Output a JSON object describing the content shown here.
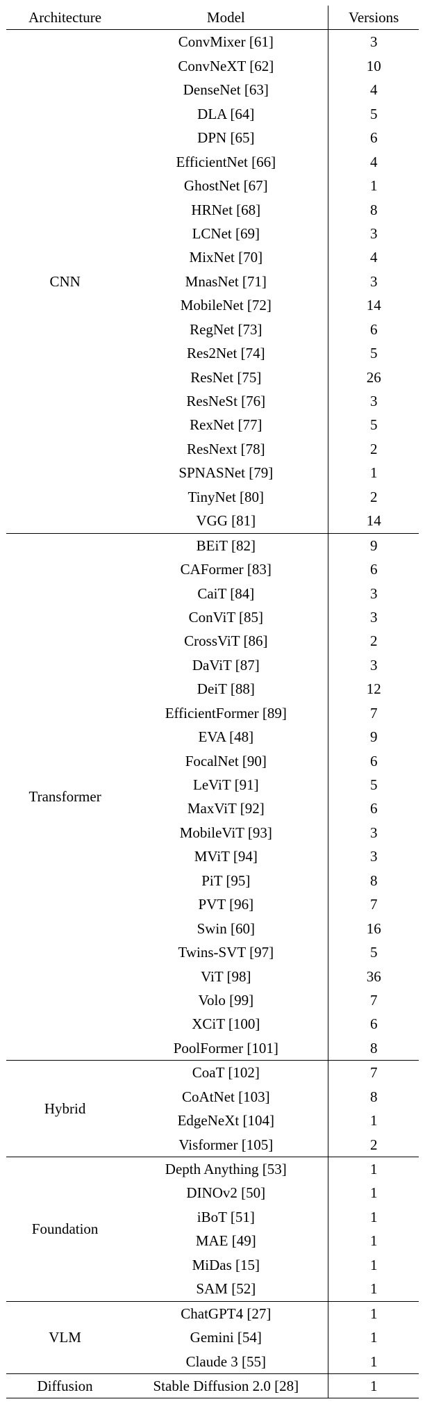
{
  "chart_data": {
    "type": "table",
    "columns": [
      "Architecture",
      "Model",
      "Versions"
    ],
    "groups": [
      {
        "architecture": "CNN",
        "rows": [
          {
            "model": "ConvMixer",
            "ref": 61,
            "versions": 3
          },
          {
            "model": "ConvNeXT",
            "ref": 62,
            "versions": 10
          },
          {
            "model": "DenseNet",
            "ref": 63,
            "versions": 4
          },
          {
            "model": "DLA",
            "ref": 64,
            "versions": 5
          },
          {
            "model": "DPN",
            "ref": 65,
            "versions": 6
          },
          {
            "model": "EfficientNet",
            "ref": 66,
            "versions": 4
          },
          {
            "model": "GhostNet",
            "ref": 67,
            "versions": 1
          },
          {
            "model": "HRNet",
            "ref": 68,
            "versions": 8
          },
          {
            "model": "LCNet",
            "ref": 69,
            "versions": 3
          },
          {
            "model": "MixNet",
            "ref": 70,
            "versions": 4
          },
          {
            "model": "MnasNet",
            "ref": 71,
            "versions": 3
          },
          {
            "model": "MobileNet",
            "ref": 72,
            "versions": 14
          },
          {
            "model": "RegNet",
            "ref": 73,
            "versions": 6
          },
          {
            "model": "Res2Net",
            "ref": 74,
            "versions": 5
          },
          {
            "model": "ResNet",
            "ref": 75,
            "versions": 26
          },
          {
            "model": "ResNeSt",
            "ref": 76,
            "versions": 3
          },
          {
            "model": "RexNet",
            "ref": 77,
            "versions": 5
          },
          {
            "model": "ResNext",
            "ref": 78,
            "versions": 2
          },
          {
            "model": "SPNASNet",
            "ref": 79,
            "versions": 1
          },
          {
            "model": "TinyNet",
            "ref": 80,
            "versions": 2
          },
          {
            "model": "VGG",
            "ref": 81,
            "versions": 14
          }
        ]
      },
      {
        "architecture": "Transformer",
        "rows": [
          {
            "model": "BEiT",
            "ref": 82,
            "versions": 9
          },
          {
            "model": "CAFormer",
            "ref": 83,
            "versions": 6
          },
          {
            "model": "CaiT",
            "ref": 84,
            "versions": 3
          },
          {
            "model": "ConViT",
            "ref": 85,
            "versions": 3
          },
          {
            "model": "CrossViT",
            "ref": 86,
            "versions": 2
          },
          {
            "model": "DaViT",
            "ref": 87,
            "versions": 3
          },
          {
            "model": "DeiT",
            "ref": 88,
            "versions": 12
          },
          {
            "model": "EfficientFormer",
            "ref": 89,
            "versions": 7
          },
          {
            "model": "EVA",
            "ref": 48,
            "versions": 9
          },
          {
            "model": "FocalNet",
            "ref": 90,
            "versions": 6
          },
          {
            "model": "LeViT",
            "ref": 91,
            "versions": 5
          },
          {
            "model": "MaxViT",
            "ref": 92,
            "versions": 6
          },
          {
            "model": "MobileViT",
            "ref": 93,
            "versions": 3
          },
          {
            "model": "MViT",
            "ref": 94,
            "versions": 3
          },
          {
            "model": "PiT",
            "ref": 95,
            "versions": 8
          },
          {
            "model": "PVT",
            "ref": 96,
            "versions": 7
          },
          {
            "model": "Swin",
            "ref": 60,
            "versions": 16
          },
          {
            "model": "Twins-SVT",
            "ref": 97,
            "versions": 5
          },
          {
            "model": "ViT",
            "ref": 98,
            "versions": 36
          },
          {
            "model": "Volo",
            "ref": 99,
            "versions": 7
          },
          {
            "model": "XCiT",
            "ref": 100,
            "versions": 6
          },
          {
            "model": "PoolFormer",
            "ref": 101,
            "versions": 8
          }
        ]
      },
      {
        "architecture": "Hybrid",
        "rows": [
          {
            "model": "CoaT",
            "ref": 102,
            "versions": 7
          },
          {
            "model": "CoAtNet",
            "ref": 103,
            "versions": 8
          },
          {
            "model": "EdgeNeXt",
            "ref": 104,
            "versions": 1
          },
          {
            "model": "Visformer",
            "ref": 105,
            "versions": 2
          }
        ]
      },
      {
        "architecture": "Foundation",
        "rows": [
          {
            "model": "Depth Anything",
            "ref": 53,
            "versions": 1
          },
          {
            "model": "DINOv2",
            "ref": 50,
            "versions": 1
          },
          {
            "model": "iBoT",
            "ref": 51,
            "versions": 1
          },
          {
            "model": "MAE",
            "ref": 49,
            "versions": 1
          },
          {
            "model": "MiDas",
            "ref": 15,
            "versions": 1
          },
          {
            "model": "SAM",
            "ref": 52,
            "versions": 1
          }
        ]
      },
      {
        "architecture": "VLM",
        "rows": [
          {
            "model": "ChatGPT4",
            "ref": 27,
            "versions": 1
          },
          {
            "model": "Gemini",
            "ref": 54,
            "versions": 1
          },
          {
            "model": "Claude 3",
            "ref": 55,
            "versions": 1
          }
        ]
      },
      {
        "architecture": "Diffusion",
        "rows": [
          {
            "model": "Stable Diffusion 2.0",
            "ref": 28,
            "versions": 1
          }
        ]
      }
    ]
  },
  "headers": {
    "arch": "Architecture",
    "model": "Model",
    "versions": "Versions"
  }
}
